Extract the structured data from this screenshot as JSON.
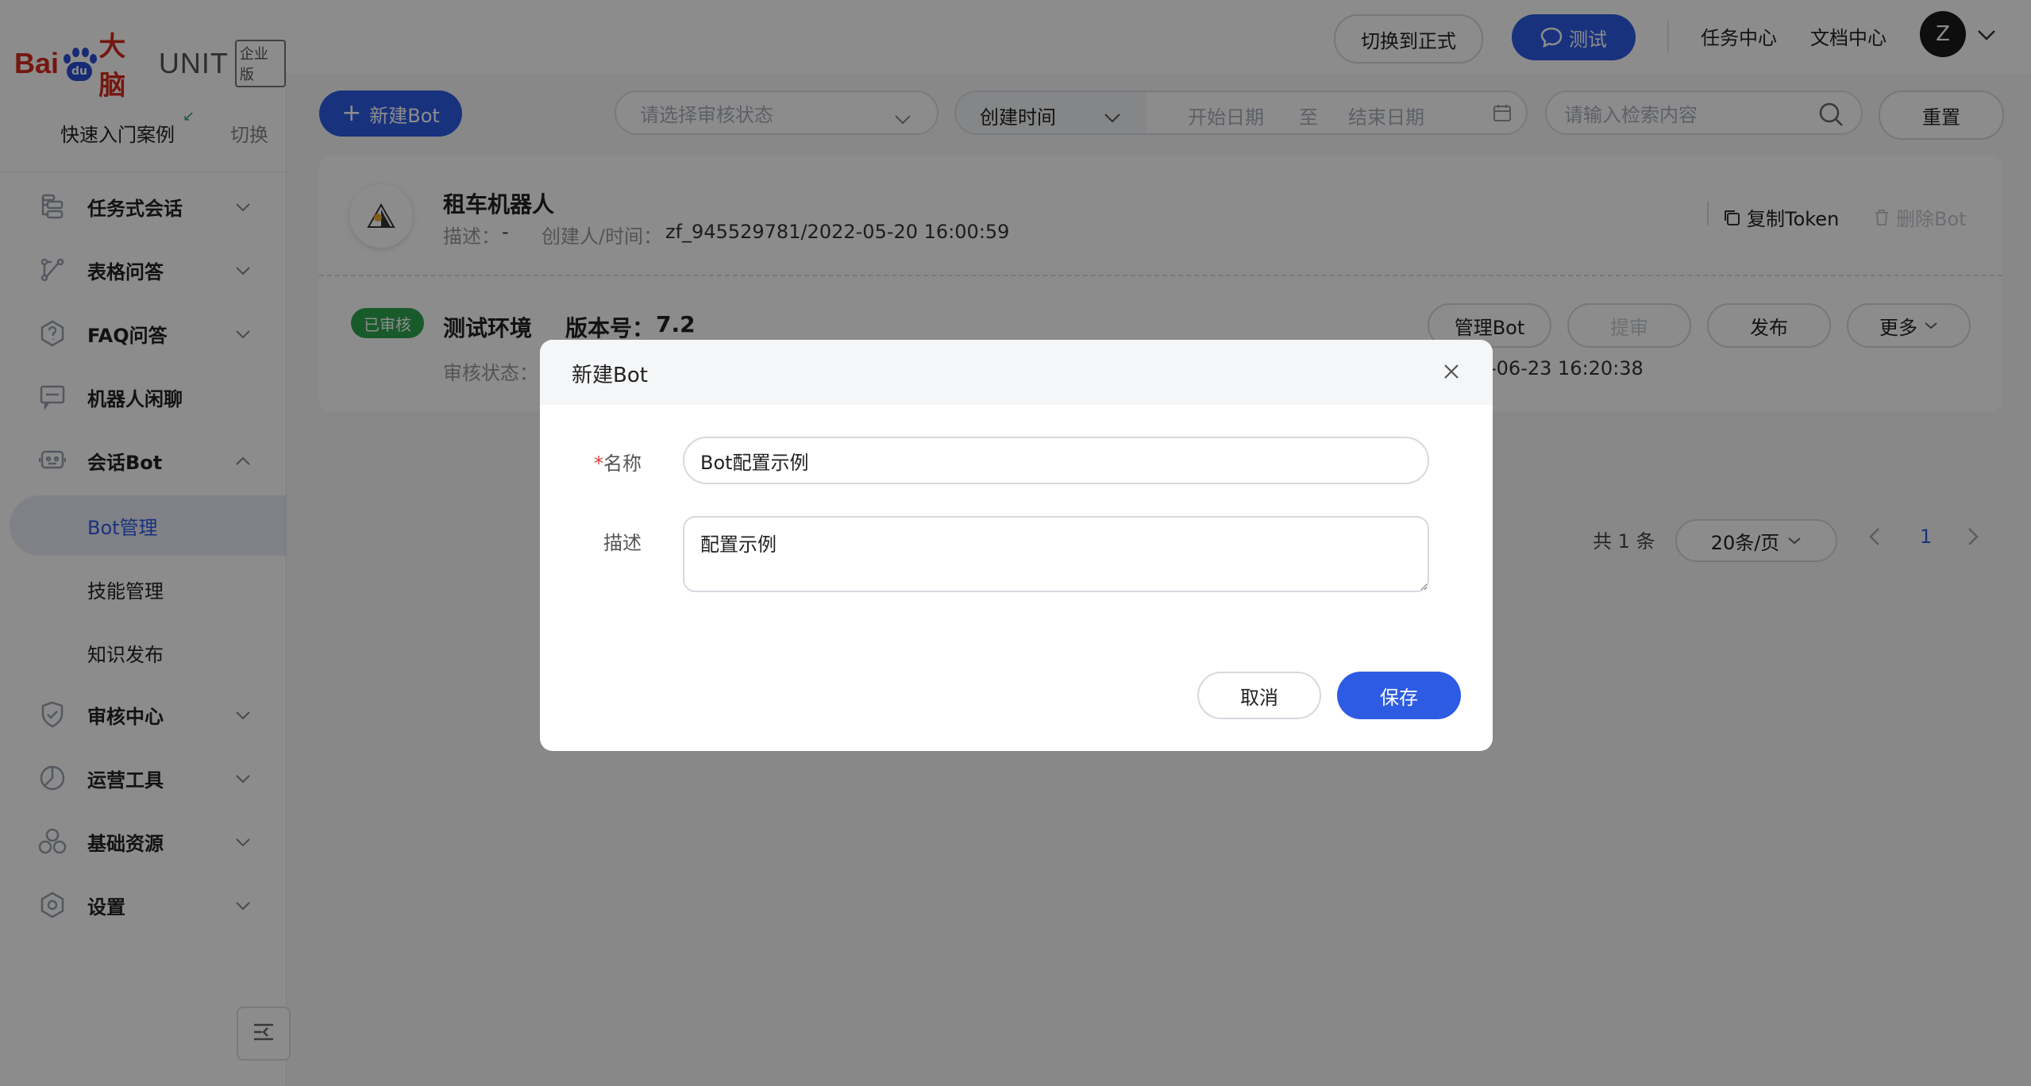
{
  "sidebar": {
    "logo": {
      "bai": "Bai",
      "du": "du",
      "brain": "大脑",
      "unit": "UNIT",
      "edition": "企业版"
    },
    "quick_start": "快速入门案例",
    "switch": "切换",
    "menu": [
      {
        "label": "任务式会话",
        "icon": "task-flow-icon",
        "expanded": false
      },
      {
        "label": "表格问答",
        "icon": "table-qa-icon",
        "expanded": false
      },
      {
        "label": "FAQ问答",
        "icon": "faq-icon",
        "expanded": false
      },
      {
        "label": "机器人闲聊",
        "icon": "chat-icon"
      },
      {
        "label": "会话Bot",
        "icon": "bot-icon",
        "expanded": true
      },
      {
        "label": "审核中心",
        "icon": "shield-icon",
        "expanded": false
      },
      {
        "label": "运营工具",
        "icon": "ops-tool-icon",
        "expanded": false
      },
      {
        "label": "基础资源",
        "icon": "resource-icon",
        "expanded": false
      },
      {
        "label": "设置",
        "icon": "settings-icon",
        "expanded": false
      }
    ],
    "submenu": [
      {
        "label": "Bot管理",
        "active": true
      },
      {
        "label": "技能管理"
      },
      {
        "label": "知识发布"
      }
    ]
  },
  "header": {
    "switch_formal": "切换到正式",
    "test": "测试",
    "task_center": "任务中心",
    "doc_center": "文档中心",
    "avatar_letter": "Z"
  },
  "toolbar": {
    "new_bot": "新建Bot",
    "audit_status_placeholder": "请选择审核状态",
    "time_type": "创建时间",
    "start_date": "开始日期",
    "to": "至",
    "end_date": "结束日期",
    "search_placeholder": "请输入检索内容",
    "reset": "重置"
  },
  "bot_card": {
    "name": "租车机器人",
    "desc_label": "描述：",
    "desc_value": "-",
    "creator_label": "创建人/时间：",
    "creator_value": "zf_945529781/2022-05-20 16:00:59",
    "copy_token": "复制Token",
    "delete_bot": "删除Bot",
    "env_badge": "已审核",
    "env_name": "测试环境",
    "version_label": "版本号：",
    "version_value": "7.2",
    "audit_label": "审核状态：",
    "time_fragment": "-06-23 16:20:38",
    "manage_bot": "管理Bot",
    "submit_audit": "提审",
    "publish": "发布",
    "more": "更多"
  },
  "pagination": {
    "total": "共 1 条",
    "page_size": "20条/页",
    "current_page": "1"
  },
  "modal": {
    "title": "新建Bot",
    "name_label": "名称",
    "name_value": "Bot配置示例",
    "desc_label": "描述",
    "desc_value": "配置示例",
    "cancel": "取消",
    "save": "保存"
  }
}
